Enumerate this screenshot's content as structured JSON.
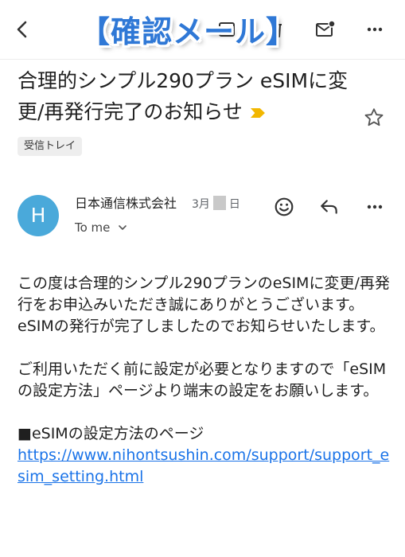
{
  "toolbar": {
    "back_icon": "arrow-back-icon",
    "archive_icon": "archive-icon",
    "delete_icon": "trash-icon",
    "unread_icon": "mark-unread-icon",
    "more_icon": "more-vert-icon"
  },
  "overlay": {
    "banner_text": "【確認メール】"
  },
  "email": {
    "subject": "合理的シンプル290プラン eSIMに変更/再発行完了のお知らせ",
    "label": "受信トレイ",
    "sender": {
      "initial": "H",
      "avatar_color": "#4aa9da",
      "name": "日本通信株式会社",
      "date_prefix": "3月",
      "date_suffix": "日",
      "recipient": "To me"
    },
    "body": {
      "para1": "この度は合理的シンプル290プランのeSIMに変更/再発行をお申込みいただき誠にありがとうございます。",
      "para2": "eSIMの発行が完了しましたのでお知らせいたします。",
      "para3": "ご利用いただく前に設定が必要となりますので「eSIMの設定方法」ページより端末の設定をお願いします。",
      "para4": "■eSIMの設定方法のページ",
      "link": "https://www.nihontsushin.com/support/support_esim_setting.html"
    }
  },
  "colors": {
    "link": "#1a73e8",
    "banner": "#2f78d6",
    "important": "#f2b700"
  }
}
